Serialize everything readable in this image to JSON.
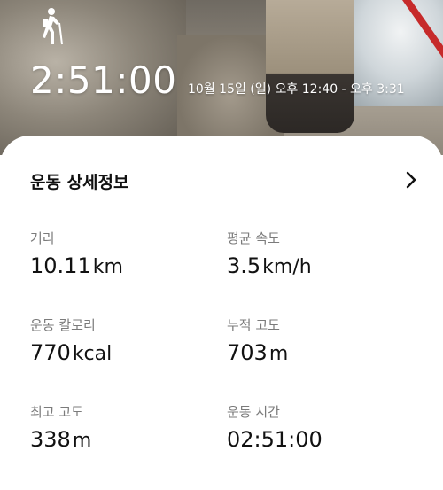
{
  "hero": {
    "icon": "hiking-person-icon",
    "duration": "2:51:00",
    "date_range": "10월 15일 (일) 오후 12:40 - 오후 3:31"
  },
  "details": {
    "title": "운동 상세정보",
    "more_icon": "chevron-right-icon",
    "stats": [
      {
        "label": "거리",
        "value": "10.11",
        "unit": "km"
      },
      {
        "label": "평균 속도",
        "value": "3.5",
        "unit": "km/h"
      },
      {
        "label": "운동 칼로리",
        "value": "770",
        "unit": "kcal"
      },
      {
        "label": "누적 고도",
        "value": "703",
        "unit": "m"
      },
      {
        "label": "최고 고도",
        "value": "338",
        "unit": "m"
      },
      {
        "label": "운동 시간",
        "value": "02:51:00",
        "unit": ""
      }
    ]
  },
  "colors": {
    "text_primary": "#111111",
    "text_secondary": "#7b7b7b",
    "card_bg": "#ffffff"
  }
}
